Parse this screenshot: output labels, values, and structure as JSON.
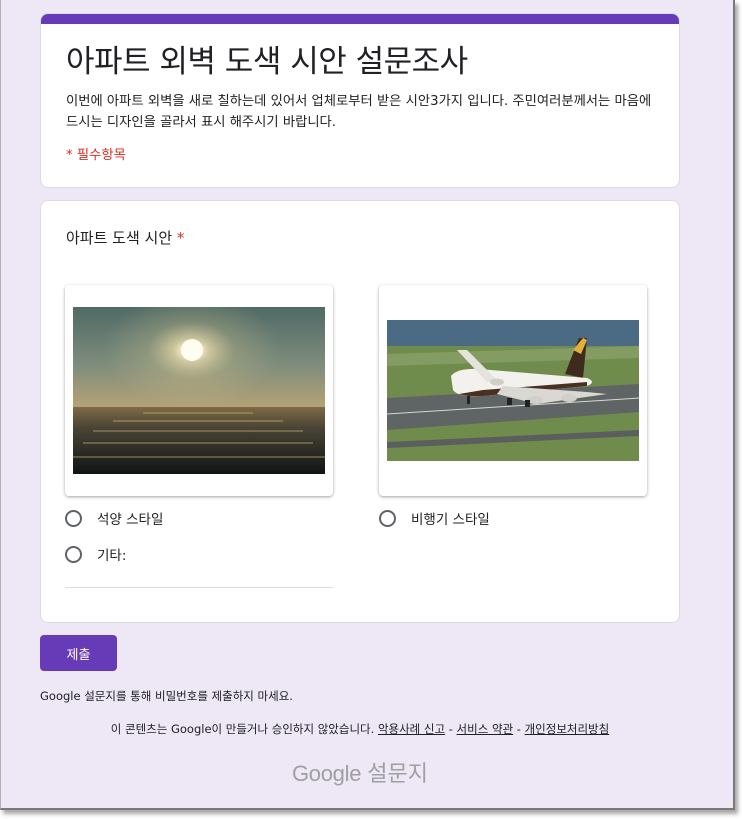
{
  "form": {
    "title": "아파트 외벽 도색 시안 설문조사",
    "description": "이번에 아파트 외벽을 새로 칠하는데 있어서 업체로부터 받은 시안3가지 입니다. 주민여러분께서는 마음에 드시는 디자인을 골라서 표시 해주시기 바랍니다.",
    "required_note": "* 필수항목"
  },
  "question": {
    "title": "아파트 도색 시안",
    "required_mark": "*",
    "options": [
      {
        "label": "석양 스타일",
        "selected": false
      },
      {
        "label": "비행기 스타일",
        "selected": false
      },
      {
        "label": "기타:",
        "selected": false
      }
    ]
  },
  "submit_label": "제출",
  "password_warning": "Google 설문지를 통해 비밀번호를 제출하지 마세요.",
  "footer": {
    "text": "이 콘텐츠는 Google이 만들거나 승인하지 않았습니다.",
    "report_link": "악용사례 신고",
    "sep": " - ",
    "terms_link": "서비스 약관",
    "privacy_link": "개인정보처리방침"
  },
  "brand": {
    "google": "Google",
    "product": "설문지"
  },
  "colors": {
    "accent": "#673ab7",
    "background": "#ede7f6",
    "required": "#d93025"
  }
}
